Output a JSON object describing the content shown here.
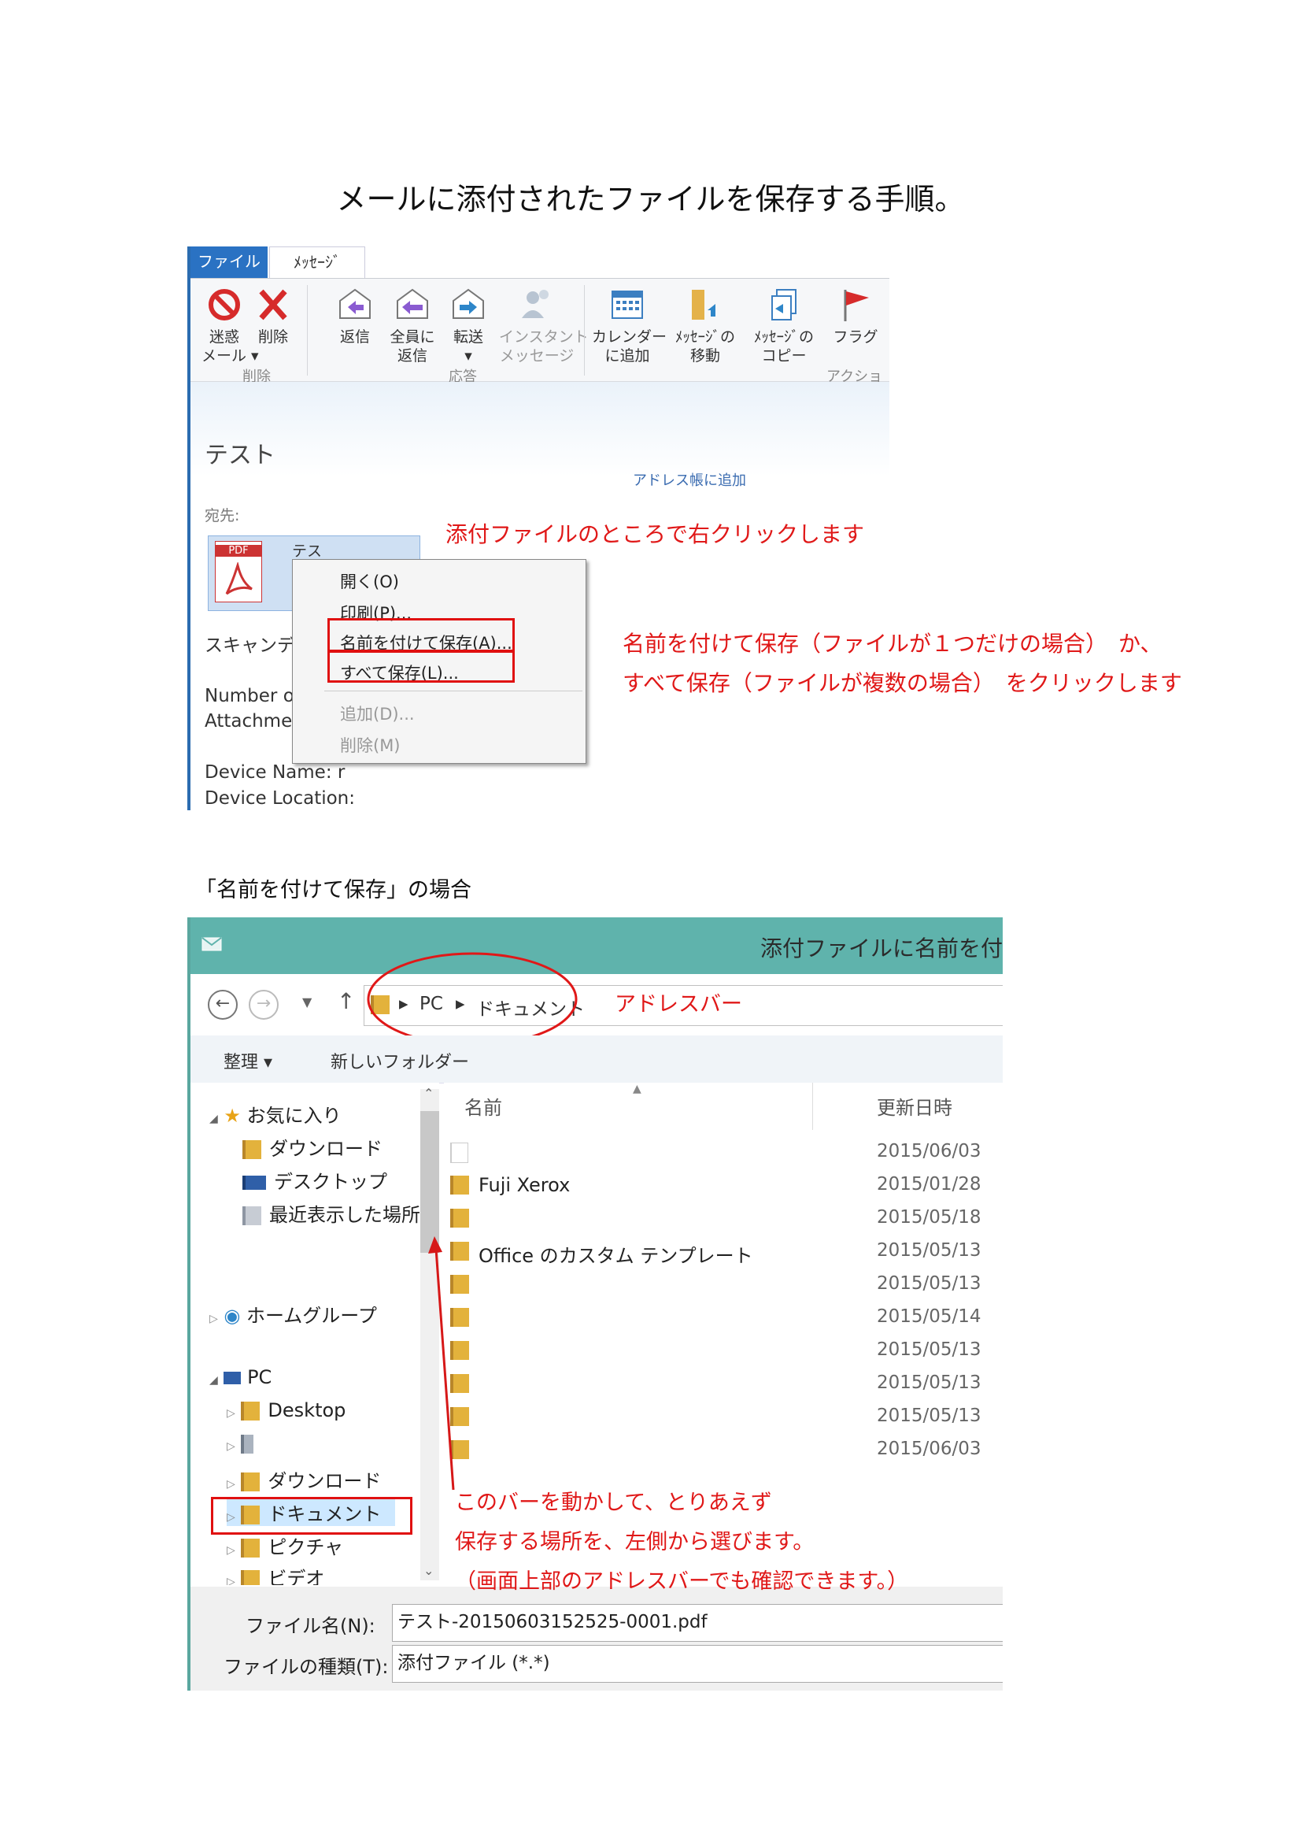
{
  "title": "メールに添付されたファイルを保存する手順。",
  "outlook": {
    "tabs": [
      "ファイル",
      "ﾒｯｾｰｼﾞ"
    ],
    "buttons": {
      "junk": "迷惑\nメール ▾",
      "delete": "削除",
      "reply": "返信",
      "reply_all": "全員に\n返信",
      "forward": "転送\n▾",
      "instant": "インスタント\nメッセージ",
      "calendar": "カレンダー\nに追加",
      "move": "ﾒｯｾｰｼﾞの\n移動",
      "copy": "ﾒｯｾｰｼﾞの\nコピー",
      "flag": "フラグ"
    },
    "groups": {
      "delete": "削除",
      "respond": "応答",
      "actions": "アクション"
    },
    "subject": "テスト",
    "add_address_book": "アドレス帳に追加",
    "to_label": "宛先: ",
    "attachment_name": "テス",
    "pdf_label": "PDF",
    "body_lines": [
      "スキャンデ",
      "Number o",
      "Attachme",
      "Device Name: r",
      "Device Location:"
    ],
    "context_menu": {
      "open": "開く(O)",
      "print": "印刷(P)...",
      "save_as": "名前を付けて保存(A)...",
      "save_all": "すべて保存(L)...",
      "add": "追加(D)...",
      "delete": "削除(M)"
    }
  },
  "notes": {
    "right_click": "添付ファイルのところで右クリックします",
    "save_line1": "名前を付けて保存（ファイルが１つだけの場合）　か、",
    "save_line2": "すべて保存（ファイルが複数の場合）　をクリックします",
    "address_bar": "アドレスバー",
    "scroll_line1": "このバーを動かして、とりあえず",
    "scroll_line2": "保存する場所を、左側から選びます。",
    "scroll_line3": "（画面上部のアドレスバーでも確認できます。）"
  },
  "caption2": "「名前を付けて保存」の場合",
  "dialog": {
    "title": "添付ファイルに名前を付",
    "address": [
      "PC",
      "ドキュメント"
    ],
    "toolbar": {
      "organize": "整理 ▾",
      "new_folder": "新しいフォルダー"
    },
    "nav": {
      "favorites": "お気に入り",
      "downloads": "ダウンロード",
      "desktop": "デスクトップ",
      "recent": "最近表示した場所",
      "homegroup": "ホームグループ",
      "pc": "PC",
      "desktop2": "Desktop",
      "downloads2": "ダウンロード",
      "documents": "ドキュメント",
      "pictures": "ピクチャ",
      "videos": "ビデオ"
    },
    "columns": {
      "name": "名前",
      "date": "更新日時"
    },
    "files": [
      {
        "name": "",
        "date": "2015/06/03"
      },
      {
        "name": "Fuji Xerox",
        "date": "2015/01/28"
      },
      {
        "name": "",
        "date": "2015/05/18"
      },
      {
        "name": "Office のカスタム テンプレート",
        "date": "2015/05/13"
      },
      {
        "name": "",
        "date": "2015/05/13"
      },
      {
        "name": "",
        "date": "2015/05/14"
      },
      {
        "name": "",
        "date": "2015/05/13"
      },
      {
        "name": "",
        "date": "2015/05/13"
      },
      {
        "name": "",
        "date": "2015/05/13"
      },
      {
        "name": "",
        "date": "2015/06/03"
      }
    ],
    "filename_label": "ファイル名(N):",
    "filename_value": "テスト-20150603152525-0001.pdf",
    "filetype_label": "ファイルの種類(T):",
    "filetype_value": "添付ファイル (*.*)"
  }
}
